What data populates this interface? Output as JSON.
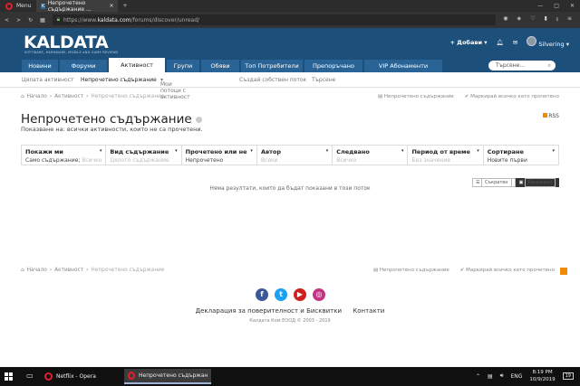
{
  "browser": {
    "menu_label": "Menu",
    "tab_title": "Непрочетено съдържание ...",
    "tab_favicon": "K",
    "new_tab": "+",
    "url_prefix": "https://www.",
    "url_domain": "kaldata.com",
    "url_path": "/forums/discover/unread/"
  },
  "site": {
    "logo": "KALDATA",
    "logo_sub": "SOFTWARE, HARDWARE, MOBILE AND GAME REVIEWS",
    "add_button": "Добави",
    "username": "Silvering",
    "search_placeholder": "Търсене...",
    "nav": [
      "Новини",
      "Форуми",
      "Активност",
      "Групи",
      "Обяви",
      "Топ Потребители",
      "Препоръчано",
      "VIP Абонаменти"
    ],
    "active_nav": 2,
    "subnav": [
      "Цялата активност",
      "Непрочетено съдържание",
      "Мои потоци с активност",
      "Създай собствен поток",
      "Търсене"
    ]
  },
  "breadcrumb": [
    "Начало",
    "Активност",
    "Непрочетено съдържание"
  ],
  "actions": {
    "unread": "Непрочетено съдържание",
    "mark_read": "Маркирай всичко като прочетено"
  },
  "page": {
    "title": "Непрочетено съдържание",
    "subtitle": "Показване на: всички активности, които не са прочетени.",
    "rss": "RSS",
    "no_results": "Няма резултати, които да бъдат показани в този поток"
  },
  "filters": [
    {
      "label": "Покажи ми",
      "value": "Само съдържание",
      "extra": "Всичко"
    },
    {
      "label": "Вид съдържание",
      "value": "Цялото съдържание",
      "placeholder": true
    },
    {
      "label": "Прочетено или не",
      "value": "Непрочетено"
    },
    {
      "label": "Автор",
      "value": "Всеки",
      "placeholder": true
    },
    {
      "label": "Следвано",
      "value": "Всичко",
      "placeholder": true
    },
    {
      "label": "Период от време",
      "value": "Без значение",
      "placeholder": true
    },
    {
      "label": "Сортиране",
      "value": "Новите първи"
    }
  ],
  "view_toggle": [
    "Съкратен",
    "Разширен"
  ],
  "footer": {
    "links": [
      "Декларация за поверителност и Бисквитки",
      "Контакти"
    ],
    "copyright": "Калдата Ком ЕООД © 2003 - 2019",
    "social": [
      {
        "name": "facebook-icon",
        "glyph": "f",
        "color": "#3b5998"
      },
      {
        "name": "twitter-icon",
        "glyph": "t",
        "color": "#1da1f2"
      },
      {
        "name": "youtube-icon",
        "glyph": "▶",
        "color": "#cd201f"
      },
      {
        "name": "instagram-icon",
        "glyph": "◎",
        "color": "#c13584"
      }
    ]
  },
  "taskbar": {
    "items": [
      "Netflix - Opera",
      "Непрочетено съдържание -..."
    ],
    "lang": "ENG",
    "time": "8:19 PM",
    "date": "10/9/2019",
    "notif": "19"
  }
}
